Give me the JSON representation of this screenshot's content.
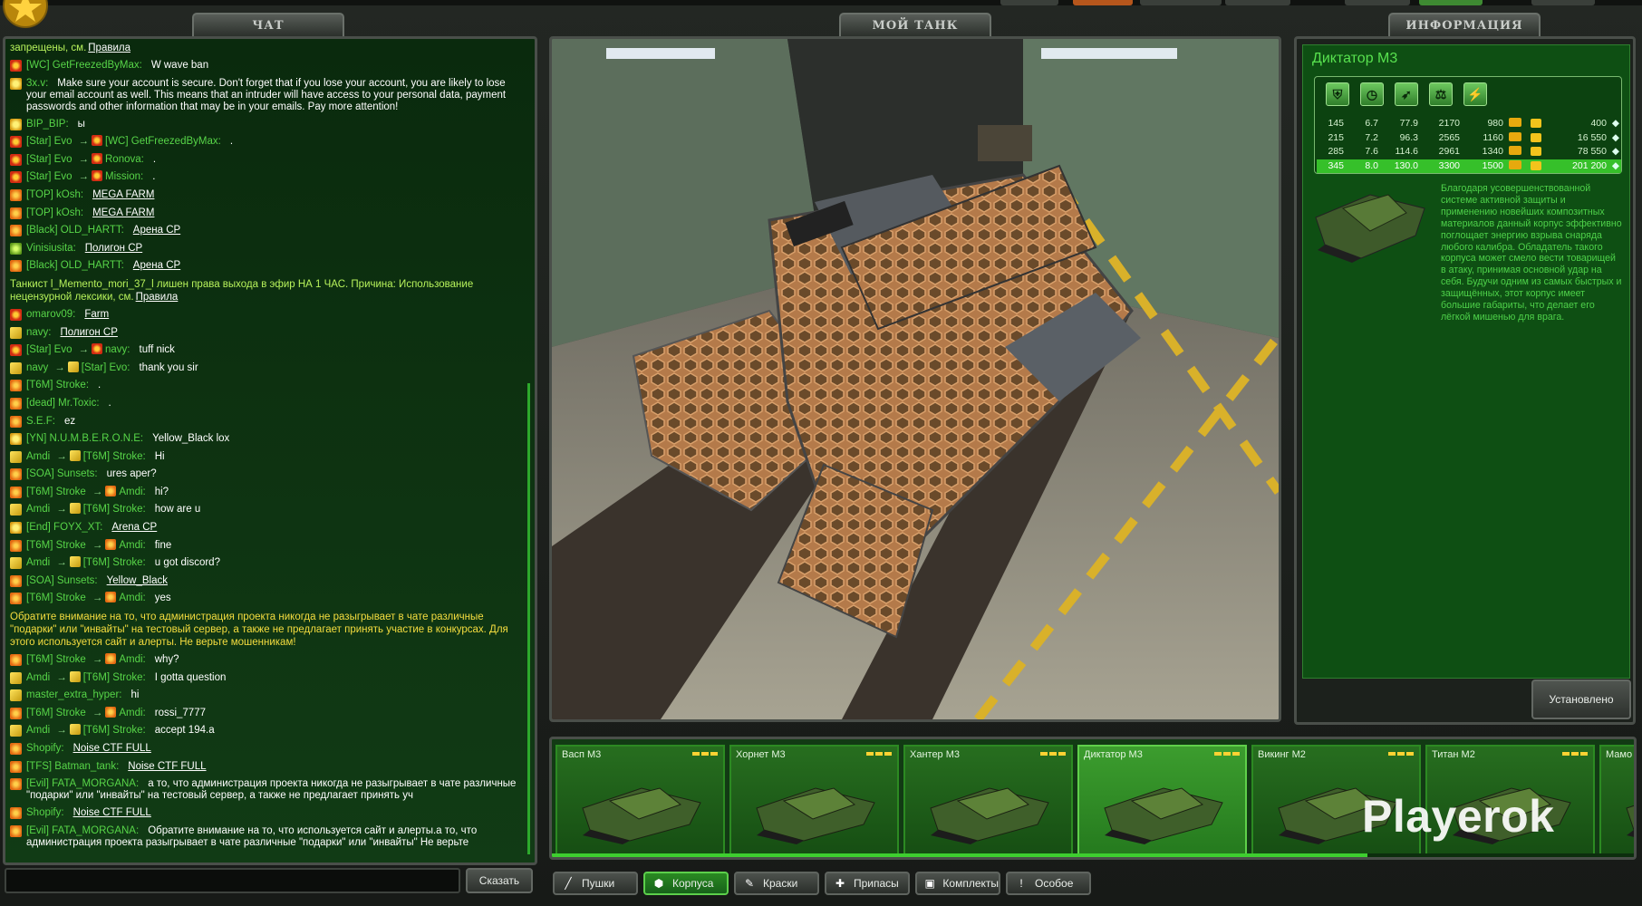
{
  "tabs": {
    "chat": "ЧАТ",
    "mytank": "МОЙ ТАНК",
    "info": "ИНФОРМАЦИЯ"
  },
  "chat": {
    "messages": [
      {
        "type": "sys",
        "text": "запрещены, см.",
        "link": "Правила"
      },
      {
        "type": "msg",
        "icon": "red",
        "nick": "[WC] GetFreezedByMax:",
        "text": "W wave ban"
      },
      {
        "type": "msg",
        "icon": "gold",
        "nick": "3x.v:",
        "text": "Make sure your account is secure. Don't forget that if you lose your account, you are likely to lose your email account as well. This means that an intruder will have access to your personal data, payment passwords and other information that may be in your emails. Pay more attention!",
        "wrap": true
      },
      {
        "type": "msg",
        "icon": "gold",
        "nick": "BIP_BIP:",
        "text": "ы"
      },
      {
        "type": "msg",
        "icon": "red",
        "nick": "[Star] Evo",
        "to": "[WC] GetFreezedByMax:",
        "text": "."
      },
      {
        "type": "msg",
        "icon": "red",
        "nick": "[Star] Evo",
        "to": "Ronova:",
        "text": "."
      },
      {
        "type": "msg",
        "icon": "red",
        "nick": "[Star] Evo",
        "to": "Mission:",
        "text": "."
      },
      {
        "type": "msg",
        "icon": "orange",
        "nick": "[TOP] kOsh:",
        "link": "MEGA FARM"
      },
      {
        "type": "msg",
        "icon": "orange",
        "nick": "[TOP] kOsh:",
        "link": "MEGA FARM"
      },
      {
        "type": "msg",
        "icon": "orange",
        "nick": "[Black] OLD_HARTT:",
        "link": "Арена CP"
      },
      {
        "type": "msg",
        "icon": "green",
        "nick": "Vinisiusita:",
        "link": "Полигон CP"
      },
      {
        "type": "msg",
        "icon": "orange",
        "nick": "[Black] OLD_HARTT:",
        "link": "Арена CP"
      },
      {
        "type": "sys",
        "text": "Танкист l_Memento_mori_37_l лишен права выхода в эфир НА 1 ЧАС. Причина: Использование нецензурной лексики, см.",
        "link": "Правила"
      },
      {
        "type": "msg",
        "icon": "red",
        "nick": "omarov09:",
        "link": "Farm"
      },
      {
        "type": "msg",
        "icon": "yellow",
        "nick": "navy:",
        "link": "Полигон CP"
      },
      {
        "type": "msg",
        "icon": "red",
        "nick": "[Star] Evo",
        "to": "navy:",
        "text": "tuff nick"
      },
      {
        "type": "msg",
        "icon": "yellow",
        "nick": "navy",
        "to": "[Star] Evo:",
        "text": "thank you sir"
      },
      {
        "type": "msg",
        "icon": "orange",
        "nick": "[T6M] Stroke:",
        "text": "."
      },
      {
        "type": "msg",
        "icon": "orange",
        "nick": "[dead] Mr.Toxic:",
        "text": "."
      },
      {
        "type": "msg",
        "icon": "orange",
        "nick": "S.E.F:",
        "text": "ez"
      },
      {
        "type": "msg",
        "icon": "gold",
        "nick": "[YN] N.U.M.B.E.R.O.N.E:",
        "text": "Yellow_Black lox"
      },
      {
        "type": "msg",
        "icon": "yellow",
        "nick": "Amdi",
        "to": "[T6M] Stroke:",
        "text": "Hi"
      },
      {
        "type": "msg",
        "icon": "orange",
        "nick": "[SOA] Sunsets:",
        "text": "ures aper?"
      },
      {
        "type": "msg",
        "icon": "orange",
        "nick": "[T6M] Stroke",
        "to": "Amdi:",
        "text": "hi?"
      },
      {
        "type": "msg",
        "icon": "yellow",
        "nick": "Amdi",
        "to": "[T6M] Stroke:",
        "text": "how are u"
      },
      {
        "type": "msg",
        "icon": "gold",
        "nick": "[End] FOYX_XT:",
        "link": "Arena CP"
      },
      {
        "type": "msg",
        "icon": "orange",
        "nick": "[T6M] Stroke",
        "to": "Amdi:",
        "text": "fine"
      },
      {
        "type": "msg",
        "icon": "yellow",
        "nick": "Amdi",
        "to": "[T6M] Stroke:",
        "text": "u got discord?"
      },
      {
        "type": "msg",
        "icon": "orange",
        "nick": "[SOA] Sunsets:",
        "link": "Yellow_Black"
      },
      {
        "type": "msg",
        "icon": "orange",
        "nick": "[T6M] Stroke",
        "to": "Amdi:",
        "text": "yes"
      },
      {
        "type": "warn",
        "text": "Обратите внимание на то, что администрация проекта никогда не разыгрывает в чате различные \"подарки\" или \"инвайты\" на тестовый сервер, а также не предлагает принять участие в конкурсах. Для этого используется сайт и алерты. Не верьте мошенникам!"
      },
      {
        "type": "msg",
        "icon": "orange",
        "nick": "[T6M] Stroke",
        "to": "Amdi:",
        "text": "why?"
      },
      {
        "type": "msg",
        "icon": "yellow",
        "nick": "Amdi",
        "to": "[T6M] Stroke:",
        "text": "I gotta question"
      },
      {
        "type": "msg",
        "icon": "yellow",
        "nick": "master_extra_hyper:",
        "text": "hi"
      },
      {
        "type": "msg",
        "icon": "orange",
        "nick": "[T6M] Stroke",
        "to": "Amdi:",
        "text": "rossi_7777"
      },
      {
        "type": "msg",
        "icon": "yellow",
        "nick": "Amdi",
        "to": "[T6M] Stroke:",
        "text": "accept 194.a"
      },
      {
        "type": "msg",
        "icon": "orange",
        "nick": "Shopify:",
        "link": "Noise CTF FULL"
      },
      {
        "type": "msg",
        "icon": "orange",
        "nick": "[TFS] Batman_tank:",
        "link": "Noise CTF FULL"
      },
      {
        "type": "msg",
        "icon": "orange",
        "nick": "[Evil] FATA_MORGANA:",
        "text": "а то, что администрация проекта никогда не разыгрывает в чате различные \"подарки\" или \"инвайты\" на тестовый сервер, а также не предлагает принять уч",
        "wrap": true
      },
      {
        "type": "msg",
        "icon": "orange",
        "nick": "Shopify:",
        "link": "Noise CTF FULL"
      },
      {
        "type": "msg",
        "icon": "orange",
        "nick": "[Evil] FATA_MORGANA:",
        "text": "Обратите внимание на то, что используется сайт и алерты.а то, что администрация проекта разыгрывает в чате различные \"подарки\" или \"инвайты\" Не верьте",
        "wrap": true
      }
    ],
    "send_label": "Сказать"
  },
  "info": {
    "tank_name": "Диктатор M3",
    "stat_icons": [
      "armor-icon",
      "speed-icon",
      "turn-icon",
      "weight-icon",
      "power-icon"
    ],
    "rows": [
      {
        "c": [
          "145",
          "6.7",
          "77.9",
          "2170",
          "980"
        ],
        "mod": "M0",
        "price": "400"
      },
      {
        "c": [
          "215",
          "7.2",
          "96.3",
          "2565",
          "1160"
        ],
        "mod": "M1",
        "price": "16 550"
      },
      {
        "c": [
          "285",
          "7.6",
          "114.6",
          "2961",
          "1340"
        ],
        "mod": "M2",
        "price": "78 550"
      },
      {
        "c": [
          "345",
          "8.0",
          "130.0",
          "3300",
          "1500"
        ],
        "mod": "M3",
        "price": "201 200",
        "selected": true
      }
    ],
    "description": "Благодаря усовершенствованной системе активной защиты и применению новейших композитных материалов данный корпус эффективно поглощает энергию взрыва снаряда любого калибра. Обладатель такого корпуса может смело вести товарищей в атаку, принимая основной удар на себя. Будучи одним из самых быстрых и защищённых, этот корпус имеет большие габариты, что делает его лёгкой мишенью для врага.",
    "installed_label": "Установлено"
  },
  "carousel": {
    "items": [
      {
        "name": "Васп M3"
      },
      {
        "name": "Хорнет M3"
      },
      {
        "name": "Хантер M3"
      },
      {
        "name": "Диктатор M3",
        "selected": true
      },
      {
        "name": "Викинг M2"
      },
      {
        "name": "Титан M2"
      },
      {
        "name": "Мамо"
      }
    ],
    "watermark": "Playerok",
    "scroll_progress": 0.75
  },
  "bottom_tabs": [
    {
      "label": "Пушки",
      "icon": "gun-icon"
    },
    {
      "label": "Корпуса",
      "icon": "hull-icon",
      "active": true
    },
    {
      "label": "Краски",
      "icon": "paint-icon"
    },
    {
      "label": "Припасы",
      "icon": "supplies-icon"
    },
    {
      "label": "Комплекты",
      "icon": "kits-icon"
    },
    {
      "label": "Особое",
      "icon": "special-icon"
    }
  ],
  "colors": {
    "accent": "#3ecf2f",
    "nick": "#57d548",
    "warn": "#f5dd3f"
  }
}
